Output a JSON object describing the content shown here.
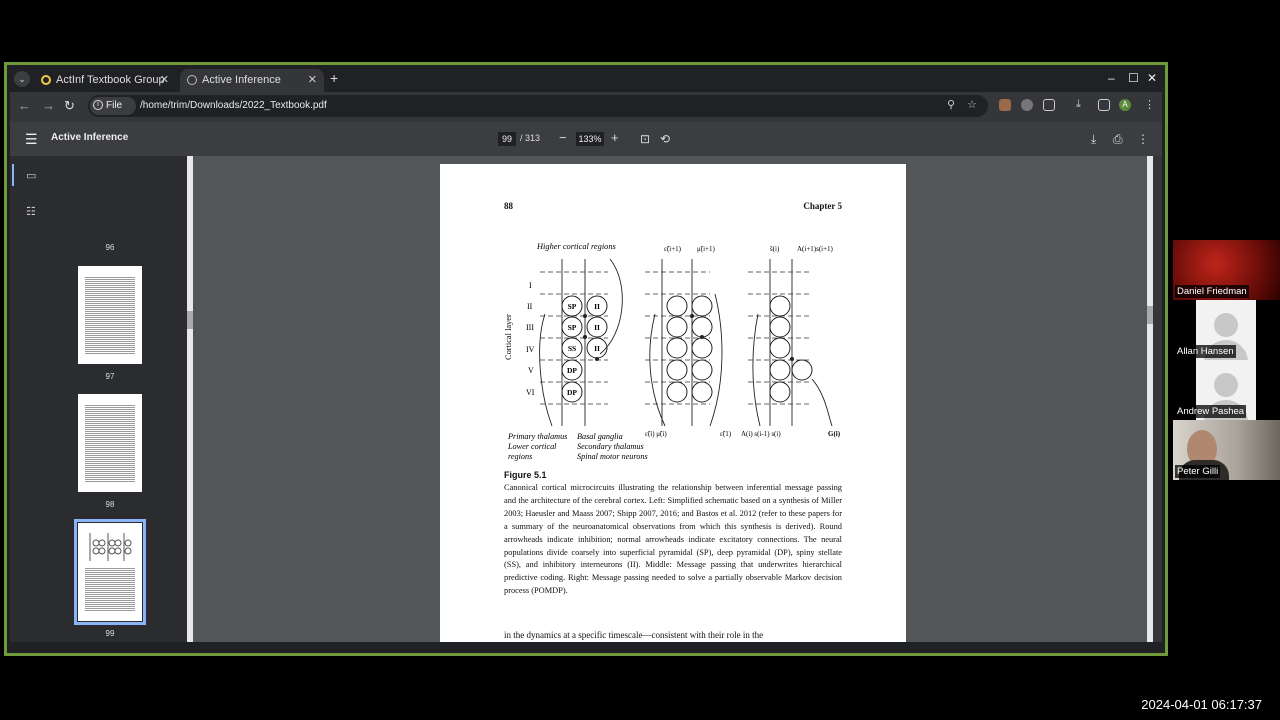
{
  "browser": {
    "tabs": [
      {
        "label": "ActInf Textbook Group",
        "active": false
      },
      {
        "label": "Active Inference",
        "active": true
      }
    ],
    "address_chip": "File",
    "url": "/home/trim/Downloads/2022_Textbook.pdf",
    "profile_initial": "A"
  },
  "pdf_viewer": {
    "title": "Active Inference",
    "current_page": "99",
    "page_count": "/ 313",
    "zoom": "133%"
  },
  "thumbnails": [
    {
      "num": "96"
    },
    {
      "num": "97"
    },
    {
      "num": "98"
    },
    {
      "num": "99",
      "selected": true
    }
  ],
  "page": {
    "number": "88",
    "chapter": "Chapter 5",
    "figure": {
      "top_label": "Higher cortical regions",
      "axis_label": "Cortical layer",
      "layers": [
        "I",
        "II",
        "III",
        "IV",
        "V",
        "VI"
      ],
      "left_cells": [
        "SP",
        "II",
        "SP",
        "II",
        "SS",
        "II",
        "DP",
        "DP"
      ],
      "bottom_labels": [
        "Primary thalamus",
        "Lower cortical",
        "regions",
        "Basal ganglia",
        "Secondary thalamus",
        "Spinal motor neurons"
      ],
      "middle_top": [
        "ε̃(i+1)",
        "μ̃(i+1)"
      ],
      "middle_bottom_left": "ε̃(i)  μ̃(i)",
      "middle_bottom_right": "ε̃(1)",
      "right_top": [
        "s̃(i)",
        "A(i+1)s(i+1)"
      ],
      "right_bottom_left": "A(i) s(i-1) s(i)",
      "right_bottom_right": "G(i)"
    },
    "figure_label": "Figure 5.1",
    "caption": "Canonical cortical microcircuits illustrating the relationship between inferential message passing and the architecture of the cerebral cortex. Left: Simplified schematic based on a synthesis of Miller 2003; Haeusler and Maass 2007; Shipp 2007, 2016; and Bastos et al. 2012 (refer to these papers for a summary of the neuroanatomical observations from which this synthesis is derived). Round arrowheads indicate inhibition; normal arrowheads indicate excitatory connections. The neural populations divide coarsely into superficial pyramidal (SP), deep pyramidal (DP), spiny stellate (SS), and inhibitory interneurons (II). Middle: Message passing that underwrites hierarchical predictive coding. Right: Message passing needed to solve a partially observable Markov decision process (POMDP).",
    "body_text": "in the dynamics at a specific timescale—consistent with their role in the"
  },
  "participants": [
    {
      "name": "Daniel Friedman",
      "tile": "red"
    },
    {
      "name": "Allan Hansen",
      "tile": "avatar"
    },
    {
      "name": "Andrew Pashea",
      "tile": "avatar"
    },
    {
      "name": "Peter Gilli",
      "tile": "camera"
    }
  ],
  "timestamp": "2024-04-01  06:17:37",
  "colors": {
    "frame_border": "#6f9a3c",
    "selected_thumb": "#8ab4f8",
    "viewer_bg": "#525659"
  }
}
